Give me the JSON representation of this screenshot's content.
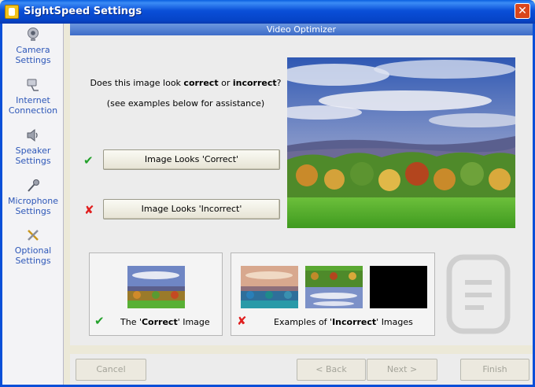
{
  "window": {
    "title": "SightSpeed Settings",
    "close_symbol": "✕"
  },
  "sidebar": {
    "items": [
      {
        "label": "Camera Settings",
        "icon": "camera-icon"
      },
      {
        "label": "Internet Connection",
        "icon": "network-icon"
      },
      {
        "label": "Speaker Settings",
        "icon": "speaker-icon"
      },
      {
        "label": "Microphone Settings",
        "icon": "microphone-icon"
      },
      {
        "label": "Optional Settings",
        "icon": "tools-icon"
      }
    ]
  },
  "banner": {
    "title": "Video Optimizer"
  },
  "prompt": {
    "q_start": "Does this image look ",
    "q_correct": "correct",
    "q_or": " or ",
    "q_incorrect": "incorrect",
    "q_end": "?",
    "hint": "(see examples below for assistance)"
  },
  "buttons": {
    "correct": "Image Looks 'Correct'",
    "incorrect": "Image Looks 'Incorrect'"
  },
  "marks": {
    "check": "✔",
    "cross": "✘"
  },
  "examples": {
    "correct_prefix": "The '",
    "correct_bold": "Correct",
    "correct_suffix": "' Image",
    "incorrect_prefix": "Examples of '",
    "incorrect_bold": "Incorrect",
    "incorrect_suffix": "' Images"
  },
  "footer": {
    "cancel": "Cancel",
    "back": "< Back",
    "next": "Next >",
    "finish": "Finish"
  },
  "colors": {
    "titlebar": "#0a4fd8",
    "banner": "#4f7fd4",
    "check": "#23a12b",
    "cross": "#e01f1f",
    "sidebar_text": "#2d57b8"
  }
}
